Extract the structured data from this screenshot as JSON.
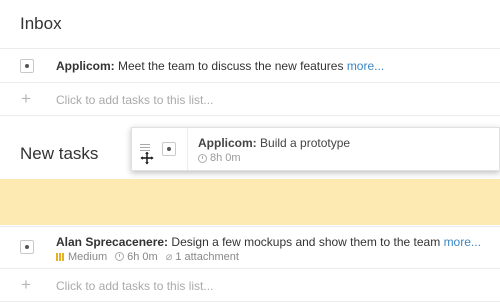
{
  "inbox": {
    "title": "Inbox",
    "task": {
      "project": "Applicom:",
      "text": "Meet the team to discuss the new features",
      "more": "more..."
    },
    "add_placeholder": "Click to add tasks to this list..."
  },
  "new_tasks": {
    "title": "New tasks",
    "task": {
      "project": "Alan Sprecacenere:",
      "text": "Design a few mockups and show them to the team",
      "more": "more...",
      "priority": "Medium",
      "estimate": "6h 0m",
      "attachments": "1 attachment"
    },
    "add_placeholder": "Click to add tasks to this list..."
  },
  "dragging_task": {
    "project": "Applicom:",
    "text": "Build a prototype",
    "estimate": "8h 0m"
  },
  "colors": {
    "drop_zone": "#fde9b2",
    "link": "#3b86c4",
    "priority_medium": "#e4b222"
  }
}
